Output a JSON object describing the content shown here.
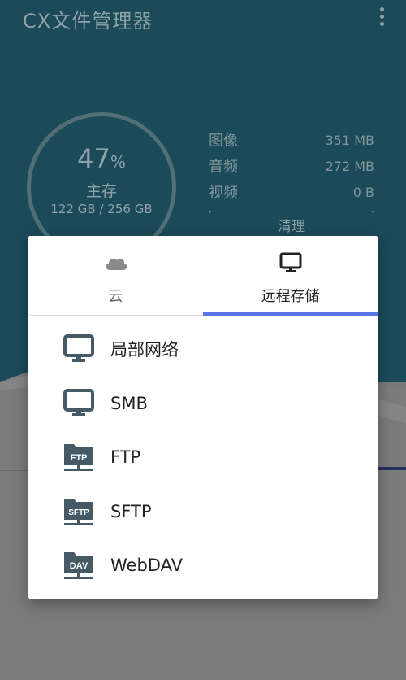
{
  "app": {
    "title": "CX文件管理器"
  },
  "storage": {
    "percent": "47",
    "percent_sign": "%",
    "label": "主存",
    "usage": "122 GB / 256 GB",
    "stats": [
      {
        "name": "图像",
        "value": "351 MB"
      },
      {
        "name": "音频",
        "value": "272 MB"
      },
      {
        "name": "视频",
        "value": "0 B"
      }
    ],
    "clean_label": "清理"
  },
  "dialog": {
    "tabs": [
      {
        "label": "云",
        "icon": "cloud-icon",
        "selected": false
      },
      {
        "label": "远程存储",
        "icon": "monitor-icon",
        "selected": true
      }
    ],
    "items": [
      {
        "label": "局部网络",
        "icon": "monitor-icon"
      },
      {
        "label": "SMB",
        "icon": "monitor-icon"
      },
      {
        "label": "FTP",
        "icon": "ftp-folder-icon",
        "badge": "FTP"
      },
      {
        "label": "SFTP",
        "icon": "sftp-folder-icon",
        "badge": "SFTP"
      },
      {
        "label": "WebDAV",
        "icon": "webdav-folder-icon",
        "badge": "DAV"
      }
    ]
  },
  "colors": {
    "accent": "#5a73e6",
    "icon": "#455a64",
    "header": "#1b4a59"
  }
}
